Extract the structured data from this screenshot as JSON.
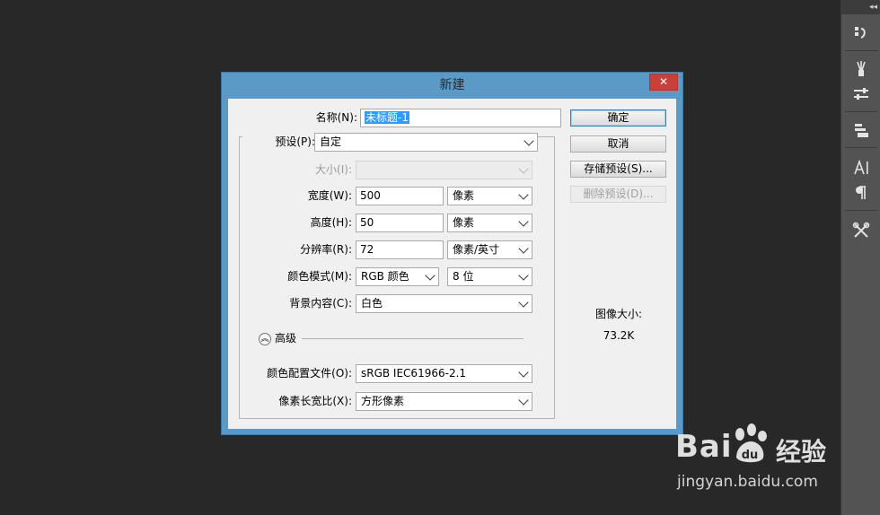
{
  "dialog": {
    "title": "新建",
    "close_symbol": "✕",
    "name": {
      "label": "名称(N):",
      "value": "未标题-1"
    },
    "preset": {
      "label": "预设(P):",
      "value": "自定"
    },
    "size": {
      "label": "大小(I):",
      "value": ""
    },
    "width": {
      "label": "宽度(W):",
      "value": "500",
      "unit": "像素"
    },
    "height": {
      "label": "高度(H):",
      "value": "50",
      "unit": "像素"
    },
    "resolution": {
      "label": "分辨率(R):",
      "value": "72",
      "unit": "像素/英寸"
    },
    "color_mode": {
      "label": "颜色模式(M):",
      "value": "RGB 颜色",
      "bits": "8 位"
    },
    "background": {
      "label": "背景内容(C):",
      "value": "白色"
    },
    "advanced": {
      "label": "高级"
    },
    "color_profile": {
      "label": "颜色配置文件(O):",
      "value": "sRGB IEC61966-2.1"
    },
    "pixel_aspect": {
      "label": "像素长宽比(X):",
      "value": "方形像素"
    },
    "buttons": {
      "ok": "确定",
      "cancel": "取消",
      "save_preset": "存储预设(S)...",
      "delete_preset": "删除预设(D)..."
    },
    "image_size": {
      "label": "图像大小:",
      "value": "73.2K"
    }
  },
  "panel": {
    "collapse": "◂◂",
    "icons": [
      "history-icon",
      "brush-icon",
      "adjust-icon",
      "layers-icon",
      "character-icon",
      "paragraph-icon",
      "tools-icon"
    ]
  },
  "watermark": {
    "logo_left": "Bai",
    "logo_right": "经验",
    "url": "jingyan.baidu.com"
  }
}
